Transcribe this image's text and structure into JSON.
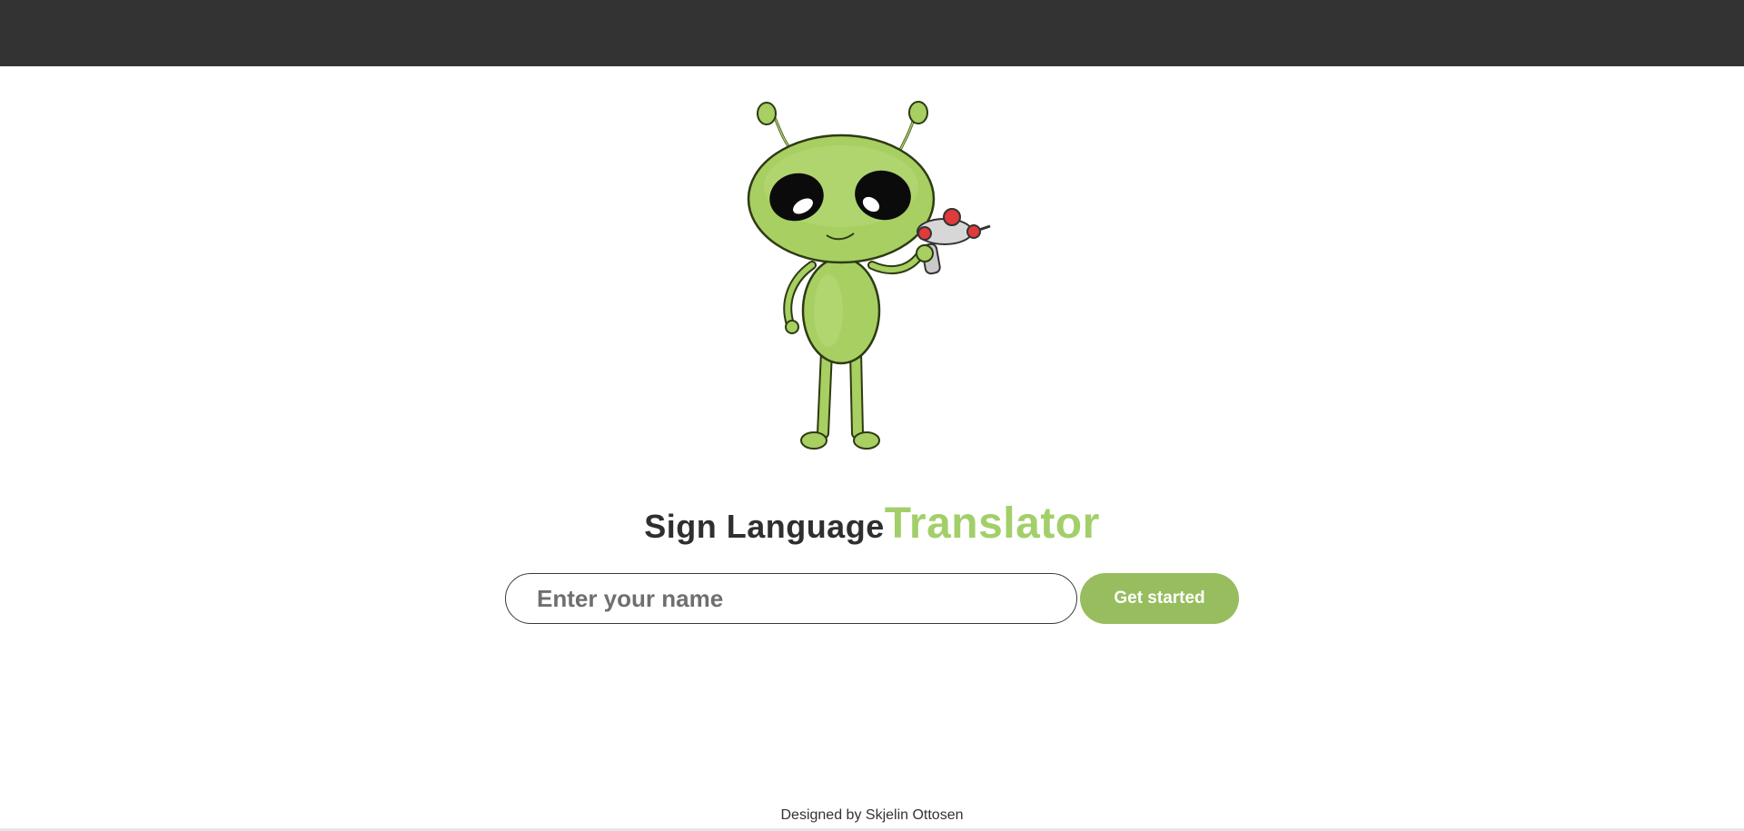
{
  "header": {
    "background": "#333333"
  },
  "mascot": {
    "icon": "alien-with-raygun-icon"
  },
  "title": {
    "part1": "Sign Language",
    "part2": "Translator",
    "accent_color": "#a3cf6a"
  },
  "login": {
    "name_placeholder": "Enter your name",
    "name_value": "",
    "button_label": "Get started",
    "button_color": "#97bd5e"
  },
  "footer": {
    "text": "Designed by Skjelin Ottosen"
  }
}
